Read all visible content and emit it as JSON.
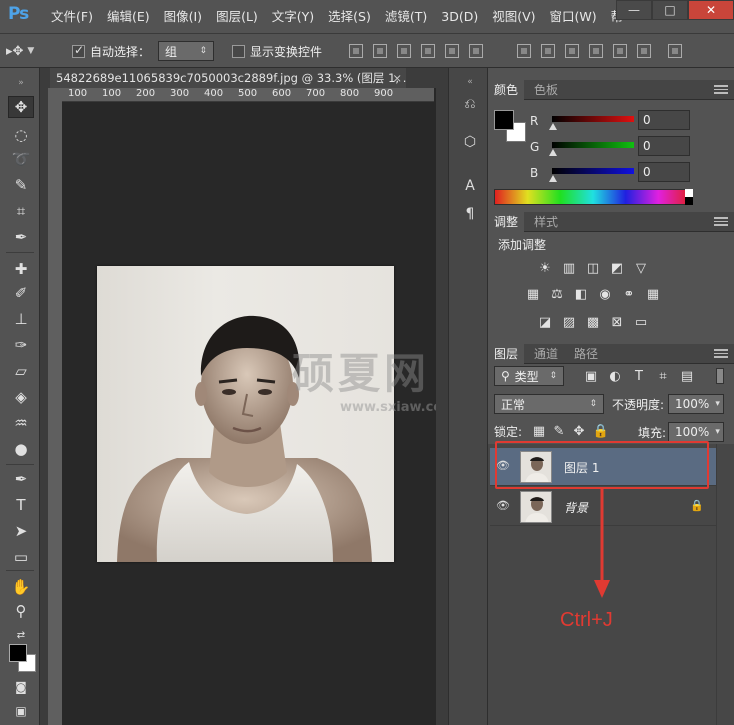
{
  "app": {
    "logo": "Ps",
    "menu": [
      "文件(F)",
      "编辑(E)",
      "图像(I)",
      "图层(L)",
      "文字(Y)",
      "选择(S)",
      "滤镜(T)",
      "3D(D)",
      "视图(V)",
      "窗口(W)",
      "帮"
    ],
    "window_controls": [
      "—",
      "□",
      "✕"
    ]
  },
  "options_bar": {
    "auto_select_label": "自动选择：",
    "auto_select_value": "组",
    "show_transform_label": "显示变换控件"
  },
  "document": {
    "tab_title": "54822689e11065839c7050003c2889f.jpg @ 33.3% (图层 1, ...",
    "ruler_labels": [
      "100",
      "100",
      "200",
      "300",
      "400",
      "500",
      "600",
      "700",
      "800",
      "900"
    ]
  },
  "color_panel": {
    "tabs": [
      "颜色",
      "色板"
    ],
    "channels": [
      {
        "label": "R",
        "value": "0",
        "gradient": "linear-gradient(90deg,#000,#e01010)"
      },
      {
        "label": "G",
        "value": "0",
        "gradient": "linear-gradient(90deg,#000,#10c010)"
      },
      {
        "label": "B",
        "value": "0",
        "gradient": "linear-gradient(90deg,#000,#1010e0)"
      }
    ]
  },
  "adjust_panel": {
    "tabs": [
      "调整",
      "样式"
    ],
    "title": "添加调整"
  },
  "layers_panel": {
    "tabs": [
      "图层",
      "通道",
      "路径"
    ],
    "filter_label": "类型",
    "blend_mode": "正常",
    "opacity_label": "不透明度:",
    "opacity_value": "100%",
    "lock_label": "锁定:",
    "fill_label": "填充:",
    "fill_value": "100%",
    "layers": [
      {
        "name": "图层 1",
        "selected": true
      },
      {
        "name": "背景",
        "selected": false,
        "locked": true
      }
    ]
  },
  "annotation": {
    "shortcut": "Ctrl+J"
  },
  "watermark": {
    "text": "硕夏网",
    "url": "www.sxiaw.com"
  },
  "colors": {
    "accent_red": "#e03a32",
    "selected_layer": "#5a6b82",
    "ps_blue": "#4ea3e8"
  }
}
